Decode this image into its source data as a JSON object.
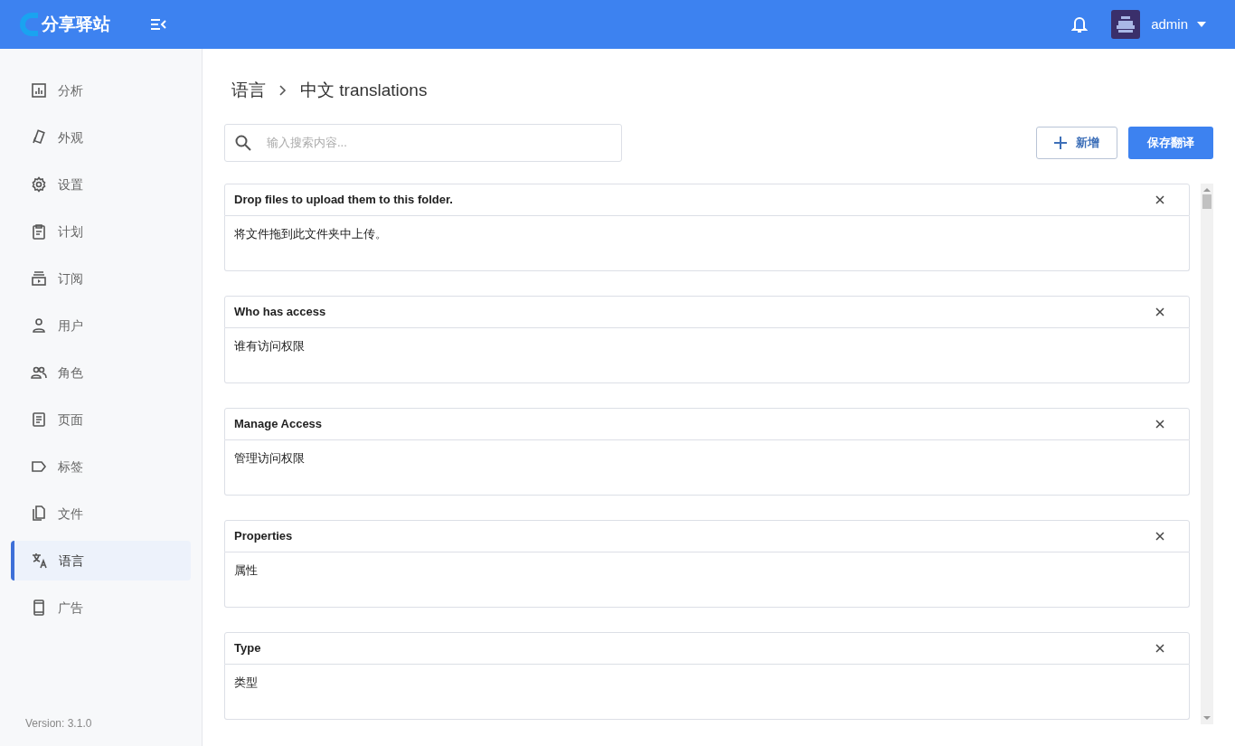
{
  "header": {
    "logo_text": "分享驿站",
    "user": "admin"
  },
  "sidebar": {
    "items": [
      {
        "label": "分析",
        "selected": false
      },
      {
        "label": "外观",
        "selected": false
      },
      {
        "label": "设置",
        "selected": false
      },
      {
        "label": "计划",
        "selected": false
      },
      {
        "label": "订阅",
        "selected": false
      },
      {
        "label": "用户",
        "selected": false
      },
      {
        "label": "角色",
        "selected": false
      },
      {
        "label": "页面",
        "selected": false
      },
      {
        "label": "标签",
        "selected": false
      },
      {
        "label": "文件",
        "selected": false
      },
      {
        "label": "语言",
        "selected": true
      },
      {
        "label": "广告",
        "selected": false
      }
    ],
    "version": "Version: 3.1.0"
  },
  "breadcrumb": [
    "语言",
    "中文 translations"
  ],
  "search": {
    "placeholder": "输入搜索内容..."
  },
  "buttons": {
    "add": "新增",
    "save": "保存翻译"
  },
  "translations": [
    {
      "key": "Drop files to upload them to this folder.",
      "value": "将文件拖到此文件夹中上传。"
    },
    {
      "key": "Who has access",
      "value": "谁有访问权限"
    },
    {
      "key": "Manage Access",
      "value": "管理访问权限"
    },
    {
      "key": "Properties",
      "value": "属性"
    },
    {
      "key": "Type",
      "value": "类型"
    }
  ]
}
